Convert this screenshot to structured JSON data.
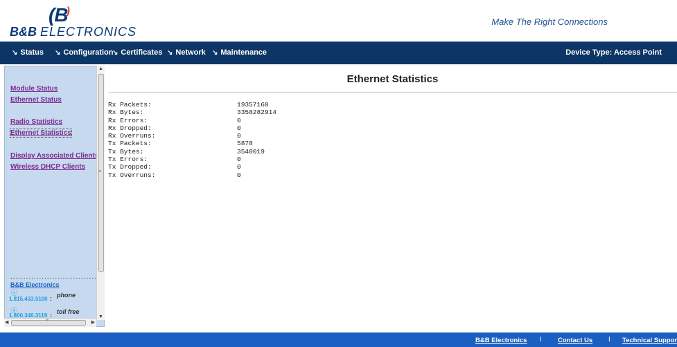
{
  "header": {
    "logo_text": "B&B ELECTRONICS",
    "logo_brand": "B&B",
    "logo_name": "ELECTRONICS",
    "logo_mark": "B",
    "tagline": "Make The Right Connections"
  },
  "nav": {
    "items": [
      {
        "label": "Status"
      },
      {
        "label": "Configuration"
      },
      {
        "label": "Certificates"
      },
      {
        "label": "Network"
      },
      {
        "label": "Maintenance"
      }
    ],
    "device_type": "Device Type: Access Point"
  },
  "sidebar": {
    "links": [
      {
        "label": "Module Status"
      },
      {
        "label": "Ethernet Status"
      },
      {
        "label": "Radio Statistics"
      },
      {
        "label": "Ethernet Statistics"
      },
      {
        "label": "Display Associated Clients"
      },
      {
        "label": "Wireless DHCP Clients"
      }
    ],
    "contact": {
      "company": "B&B Electronics",
      "phone_number": "1.815.433.5100",
      "phone_label": "phone",
      "tollfree_number": "1.800.346.3119",
      "tollfree_label": "toll free"
    }
  },
  "main": {
    "title": "Ethernet Statistics",
    "stats": [
      {
        "label": "Rx Packets:",
        "value": "19357160"
      },
      {
        "label": "Rx Bytes:",
        "value": "3358282914"
      },
      {
        "label": "Rx Errors:",
        "value": "0"
      },
      {
        "label": "Rx Dropped:",
        "value": "0"
      },
      {
        "label": "Rx Overruns:",
        "value": "0"
      },
      {
        "label": "Tx Packets:",
        "value": "5878"
      },
      {
        "label": "Tx Bytes:",
        "value": "3540019"
      },
      {
        "label": "Tx Errors:",
        "value": "0"
      },
      {
        "label": "Tx Dropped:",
        "value": "0"
      },
      {
        "label": "Tx Overruns:",
        "value": "0"
      }
    ]
  },
  "footer": {
    "links": [
      {
        "label": "B&B Electronics"
      },
      {
        "label": "Contact Us"
      },
      {
        "label": "Technical Support"
      }
    ],
    "separator": "I"
  }
}
